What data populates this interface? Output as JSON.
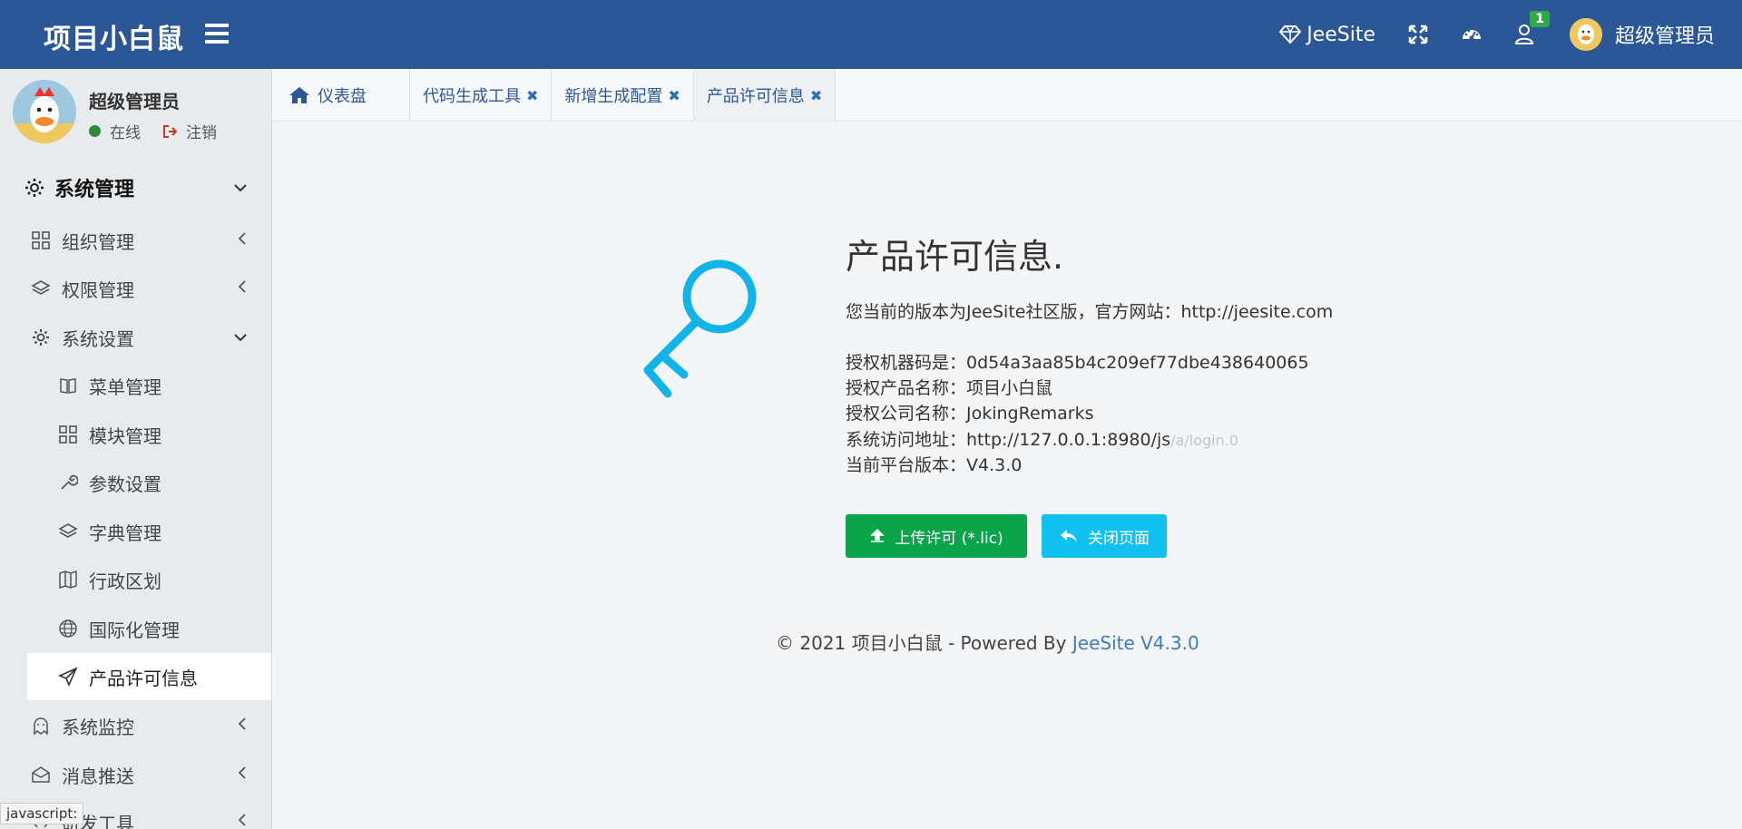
{
  "header": {
    "brand": "项目小白鼠",
    "jeesite_label": "JeeSite",
    "notification_count": "1",
    "user_name": "超级管理员"
  },
  "sidebar": {
    "user_name": "超级管理员",
    "status": "在线",
    "logout": "注销",
    "top_menu": "系统管理",
    "items": [
      {
        "label": "组织管理",
        "icon": "grid-icon"
      },
      {
        "label": "权限管理",
        "icon": "layers-icon"
      },
      {
        "label": "系统设置",
        "icon": "gear-icon"
      },
      {
        "label": "菜单管理",
        "icon": "book-icon"
      },
      {
        "label": "模块管理",
        "icon": "grid-icon"
      },
      {
        "label": "参数设置",
        "icon": "wrench-icon"
      },
      {
        "label": "字典管理",
        "icon": "layers-icon"
      },
      {
        "label": "行政区划",
        "icon": "map-icon"
      },
      {
        "label": "国际化管理",
        "icon": "globe-icon"
      },
      {
        "label": "产品许可信息",
        "icon": "send-icon"
      },
      {
        "label": "系统监控",
        "icon": "ghost-icon"
      },
      {
        "label": "消息推送",
        "icon": "envelope-icon"
      },
      {
        "label": "研发工具",
        "icon": "code-icon"
      }
    ],
    "status_tooltip": "javascript:"
  },
  "tabs": [
    {
      "label": "仪表盘"
    },
    {
      "label": "代码生成工具"
    },
    {
      "label": "新增生成配置"
    },
    {
      "label": "产品许可信息"
    }
  ],
  "license": {
    "title": "产品许可信息.",
    "version_line": "您当前的版本为JeeSite社区版，官方网站：http://jeesite.com",
    "machine_code": "授权机器码是：0d54a3aa85b4c209ef77dbe438640065",
    "product_name": "授权产品名称：项目小白鼠",
    "company_name": "授权公司名称：JokingRemarks",
    "access_url_prefix": "系统访问地址：http://127.0.0.1:8980/js",
    "access_url_suffix": "/a/login.0",
    "platform_version": "当前平台版本：V4.3.0",
    "upload_button": "上传许可 (*.lic)",
    "close_button": "关闭页面"
  },
  "footer": {
    "text": "© 2021 项目小白鼠 - Powered By ",
    "link": "JeeSite V4.3.0"
  },
  "colors": {
    "header_bg": "#2b5797",
    "green_button": "#0aa54a",
    "cyan_button": "#10c0f0",
    "key_icon": "#10b4e8"
  }
}
